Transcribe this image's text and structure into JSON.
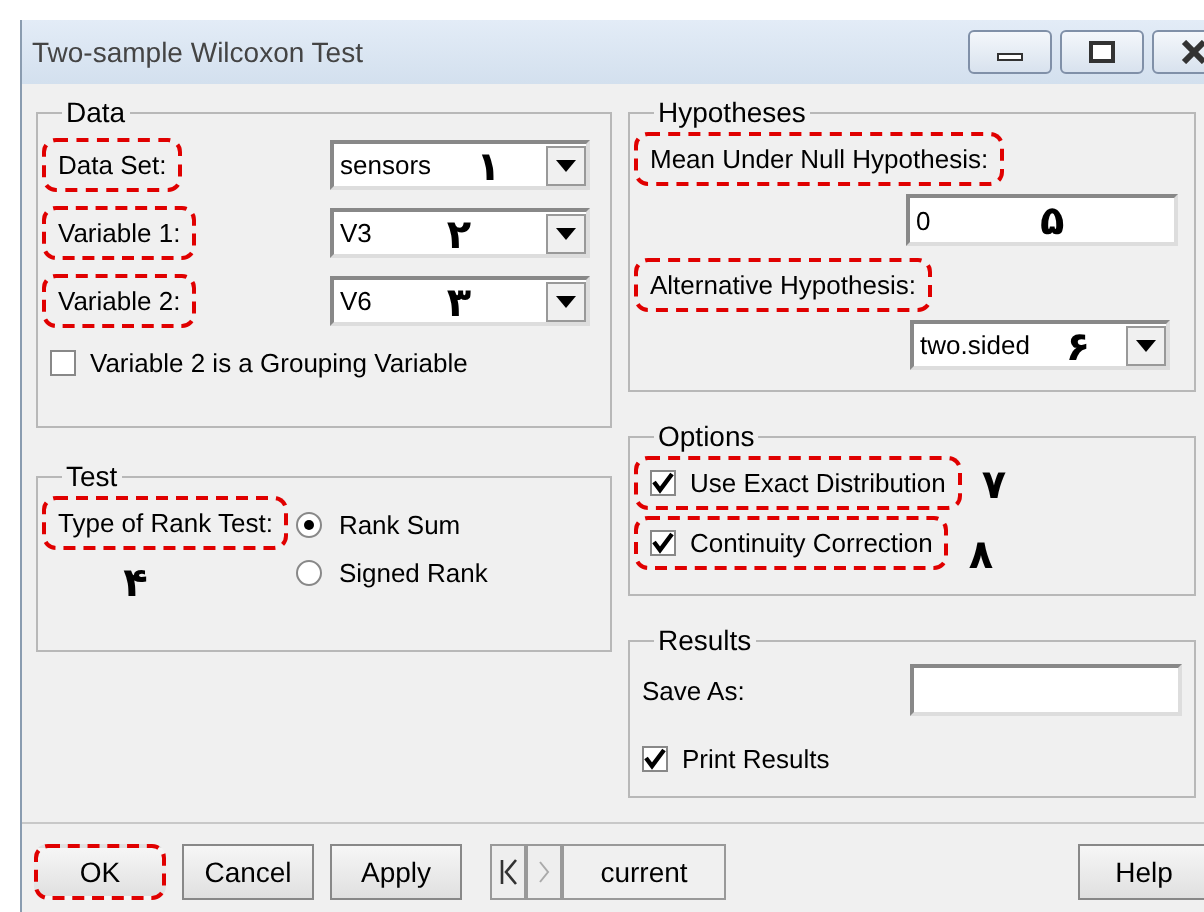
{
  "window": {
    "title": "Two-sample Wilcoxon Test"
  },
  "data_group": {
    "title": "Data",
    "fields": [
      {
        "label": "Data Set:",
        "value": "sensors",
        "marker": "۱",
        "highlighted": true
      },
      {
        "label": "Variable 1:",
        "value": "V3",
        "marker": "۲",
        "highlighted": true
      },
      {
        "label": "Variable 2:",
        "value": "V6",
        "marker": "۳",
        "highlighted": true
      }
    ],
    "grouping_checkbox": {
      "label": "Variable 2 is a Grouping Variable",
      "checked": false
    }
  },
  "test_group": {
    "title": "Test",
    "label": "Type of Rank Test:",
    "highlighted": true,
    "marker": "۴",
    "options": [
      {
        "label": "Rank Sum",
        "selected": true
      },
      {
        "label": "Signed Rank",
        "selected": false
      }
    ]
  },
  "hypotheses_group": {
    "title": "Hypotheses",
    "null_label": "Mean Under Null Hypothesis:",
    "null_highlighted": true,
    "null_value": "0",
    "null_marker": "۵",
    "alt_label": "Alternative Hypothesis:",
    "alt_highlighted": true,
    "alt_value": "two.sided",
    "alt_marker": "۶"
  },
  "options_group": {
    "title": "Options",
    "items": [
      {
        "label": "Use Exact Distribution",
        "checked": true,
        "highlighted": true,
        "marker": "۷"
      },
      {
        "label": "Continuity Correction",
        "checked": true,
        "highlighted": true,
        "marker": "۸"
      }
    ]
  },
  "results_group": {
    "title": "Results",
    "save_label": "Save As:",
    "print": {
      "label": "Print Results",
      "checked": true
    }
  },
  "buttons": [
    {
      "label": "OK",
      "highlighted": true
    },
    {
      "label": "Cancel",
      "highlighted": false
    },
    {
      "label": "Apply",
      "highlighted": false
    }
  ],
  "navigator": {
    "value": "current"
  },
  "help": "Help"
}
